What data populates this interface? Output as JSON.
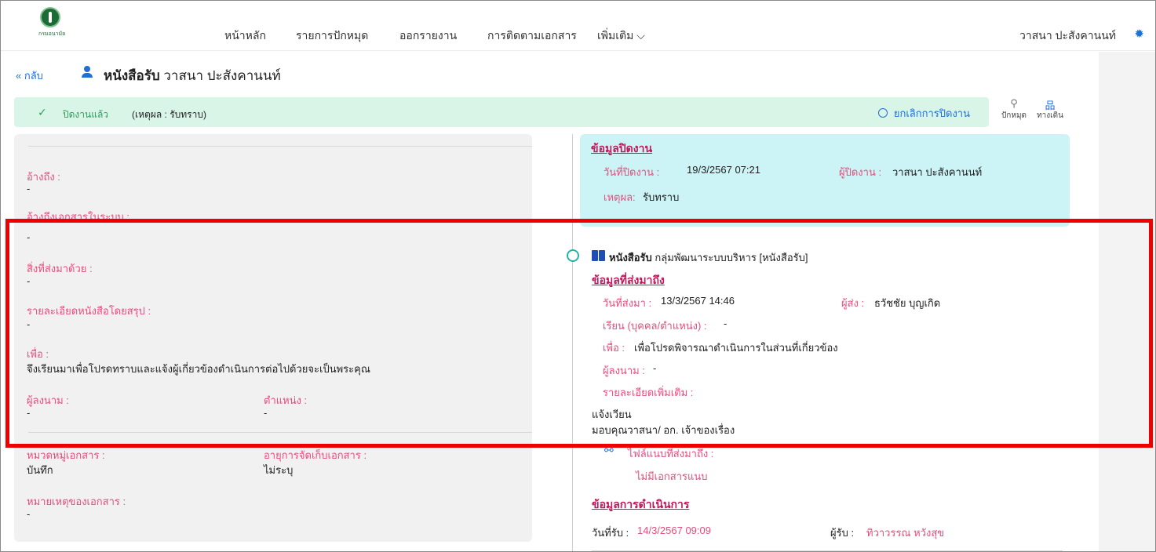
{
  "nav": {
    "logo_text": "กรมอนามัย",
    "items": [
      "หน้าหลัก",
      "รายการปักหมุด",
      "ออกรายงาน",
      "การติดตามเอกสาร",
      "เพิ่มเติม ⌵"
    ],
    "user": "วาสนา ปะสังคานนท์"
  },
  "header": {
    "back": "« กลับ",
    "doc_type": "หนังสือรับ",
    "owner": "วาสนา ปะสังคานนท์"
  },
  "status": {
    "closed": "ปิดงานแล้ว",
    "reason": "(เหตุผล : รับทราบ)",
    "undo": "ยกเลิกการปิดงาน"
  },
  "tools": {
    "pin": "ปักหมุด",
    "route": "ทางเดิน"
  },
  "left": {
    "ref_label": "อ้างถึง :",
    "ref_value": "-",
    "ref_sys_label": "อ้างถึงเอกสารในระบบ :",
    "ref_sys_value": "-",
    "enclosed_label": "สิ่งที่ส่งมาด้วย :",
    "enclosed_value": "-",
    "summary_label": "รายละเอียดหนังสือโดยสรุป :",
    "summary_value": "-",
    "purpose_label": "เพื่อ :",
    "purpose_value": "จึงเรียนมาเพื่อโปรดทราบและแจ้งผู้เกี่ยวข้องดำเนินการต่อไปด้วยจะเป็นพระคุณ",
    "signer_label": "ผู้ลงนาม :",
    "signer_value": "-",
    "position_label": "ตำแหน่ง :",
    "position_value": "-",
    "category_label": "หมวดหมู่เอกสาร :",
    "category_value": "บันทึก",
    "retention_label": "อายุการจัดเก็บเอกสาร :",
    "retention_value": "ไม่ระบุ",
    "note_label": "หมายเหตุของเอกสาร :",
    "note_value": "-"
  },
  "closing": {
    "title": "ข้อมูลปิดงาน",
    "date_label": "วันที่ปิดงาน :",
    "date_value": "19/3/2567 07:21",
    "closer_label": "ผู้ปิดงาน :",
    "closer_value": "วาสนา ปะสังคานนท์",
    "reason_label": "เหตุผล:",
    "reason_value": "รับทราบ"
  },
  "timeline": {
    "doc_type": "หนังสือรับ",
    "doc_group": "กลุ่มพัฒนาระบบบริหาร [หนังสือรับ]",
    "sent_title": "ข้อมูลที่ส่งมาถึง",
    "sent_date_label": "วันที่ส่งมา :",
    "sent_date_value": "13/3/2567 14:46",
    "sender_label": "ผู้ส่ง :",
    "sender_value": "ธวัชชัย บุญเกิด",
    "to_label": "เรียน (บุคคล/ตำแหน่ง) :",
    "to_value": "-",
    "purpose_label": "เพื่อ :",
    "purpose_value": "เพื่อโปรดพิจารณาดำเนินการในส่วนที่เกี่ยวข้อง",
    "signer_label": "ผู้ลงนาม :",
    "signer_value": "-",
    "detail_label": "รายละเอียดเพิ่มเติม :",
    "detail_line1": "แจ้งเวียน",
    "detail_line2": "มอบคุณวาสนา/ อก. เจ้าของเรื่อง",
    "attach_label": "ไฟล์แนบที่ส่งมาถึง :",
    "no_attach": "ไม่มีเอกสารแนบ",
    "action_title": "ข้อมูลการดำเนินการ",
    "recv_date_label": "วันที่รับ :",
    "recv_date_value": "14/3/2567 09:09",
    "receiver_label": "ผู้รับ :",
    "receiver_value": "ทิวาวรรณ หวังสุข"
  }
}
